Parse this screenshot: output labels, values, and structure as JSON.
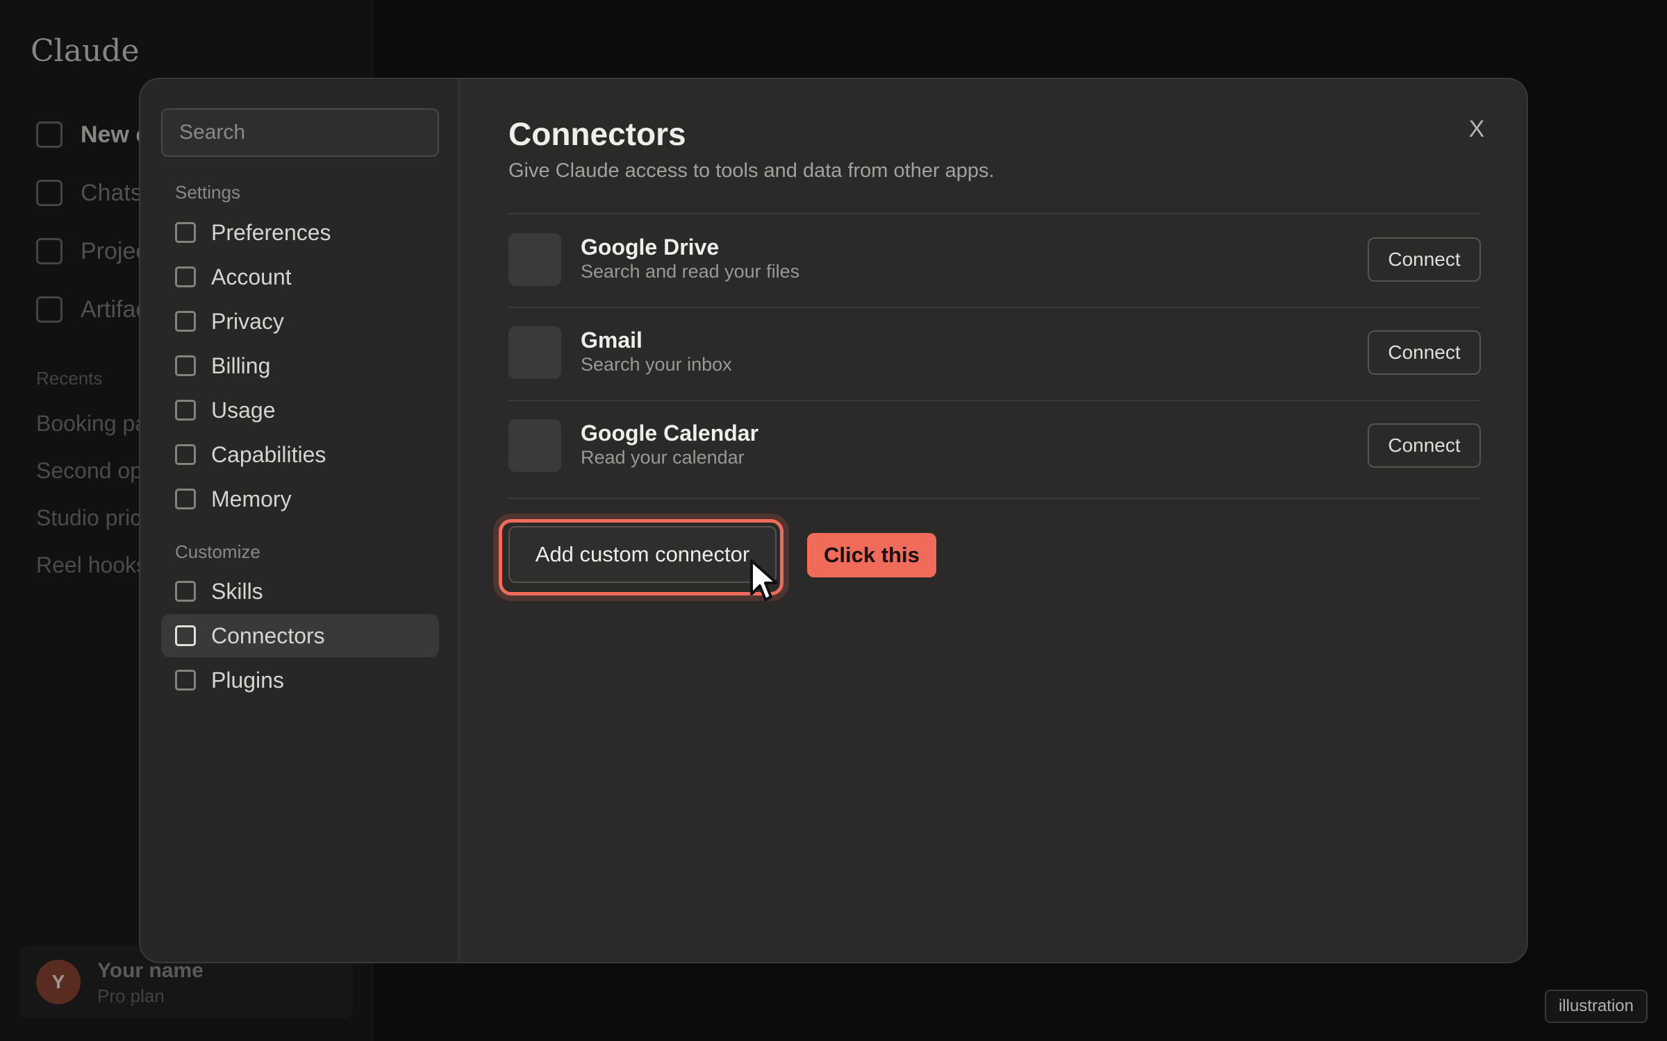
{
  "app": {
    "brand": "Claude",
    "nav": [
      {
        "label": "New chat"
      },
      {
        "label": "Chats"
      },
      {
        "label": "Projects"
      },
      {
        "label": "Artifacts"
      }
    ],
    "recents_label": "Recents",
    "recents": [
      "Booking page",
      "Second opinion",
      "Studio pricing",
      "Reel hooks"
    ],
    "user": {
      "initial": "Y",
      "name": "Your name",
      "plan": "Pro plan"
    }
  },
  "modal": {
    "search_placeholder": "Search",
    "settings_label": "Settings",
    "settings_items": [
      "Preferences",
      "Account",
      "Privacy",
      "Billing",
      "Usage",
      "Capabilities",
      "Memory"
    ],
    "customize_label": "Customize",
    "customize_items": [
      "Skills",
      "Connectors",
      "Plugins"
    ],
    "active_item": "Connectors",
    "title": "Connectors",
    "subtitle": "Give Claude access to tools and data from other apps.",
    "close_label": "X",
    "connectors": [
      {
        "name": "Google Drive",
        "desc": "Search and read your files",
        "button": "Connect"
      },
      {
        "name": "Gmail",
        "desc": "Search your inbox",
        "button": "Connect"
      },
      {
        "name": "Google Calendar",
        "desc": "Read your calendar",
        "button": "Connect"
      }
    ],
    "add_custom": "Add custom connector",
    "tooltip": "Click this"
  },
  "watermark": "illustration",
  "colors": {
    "accent": "#f06b5a",
    "background": "#161616",
    "modal": "#2b2a29"
  }
}
